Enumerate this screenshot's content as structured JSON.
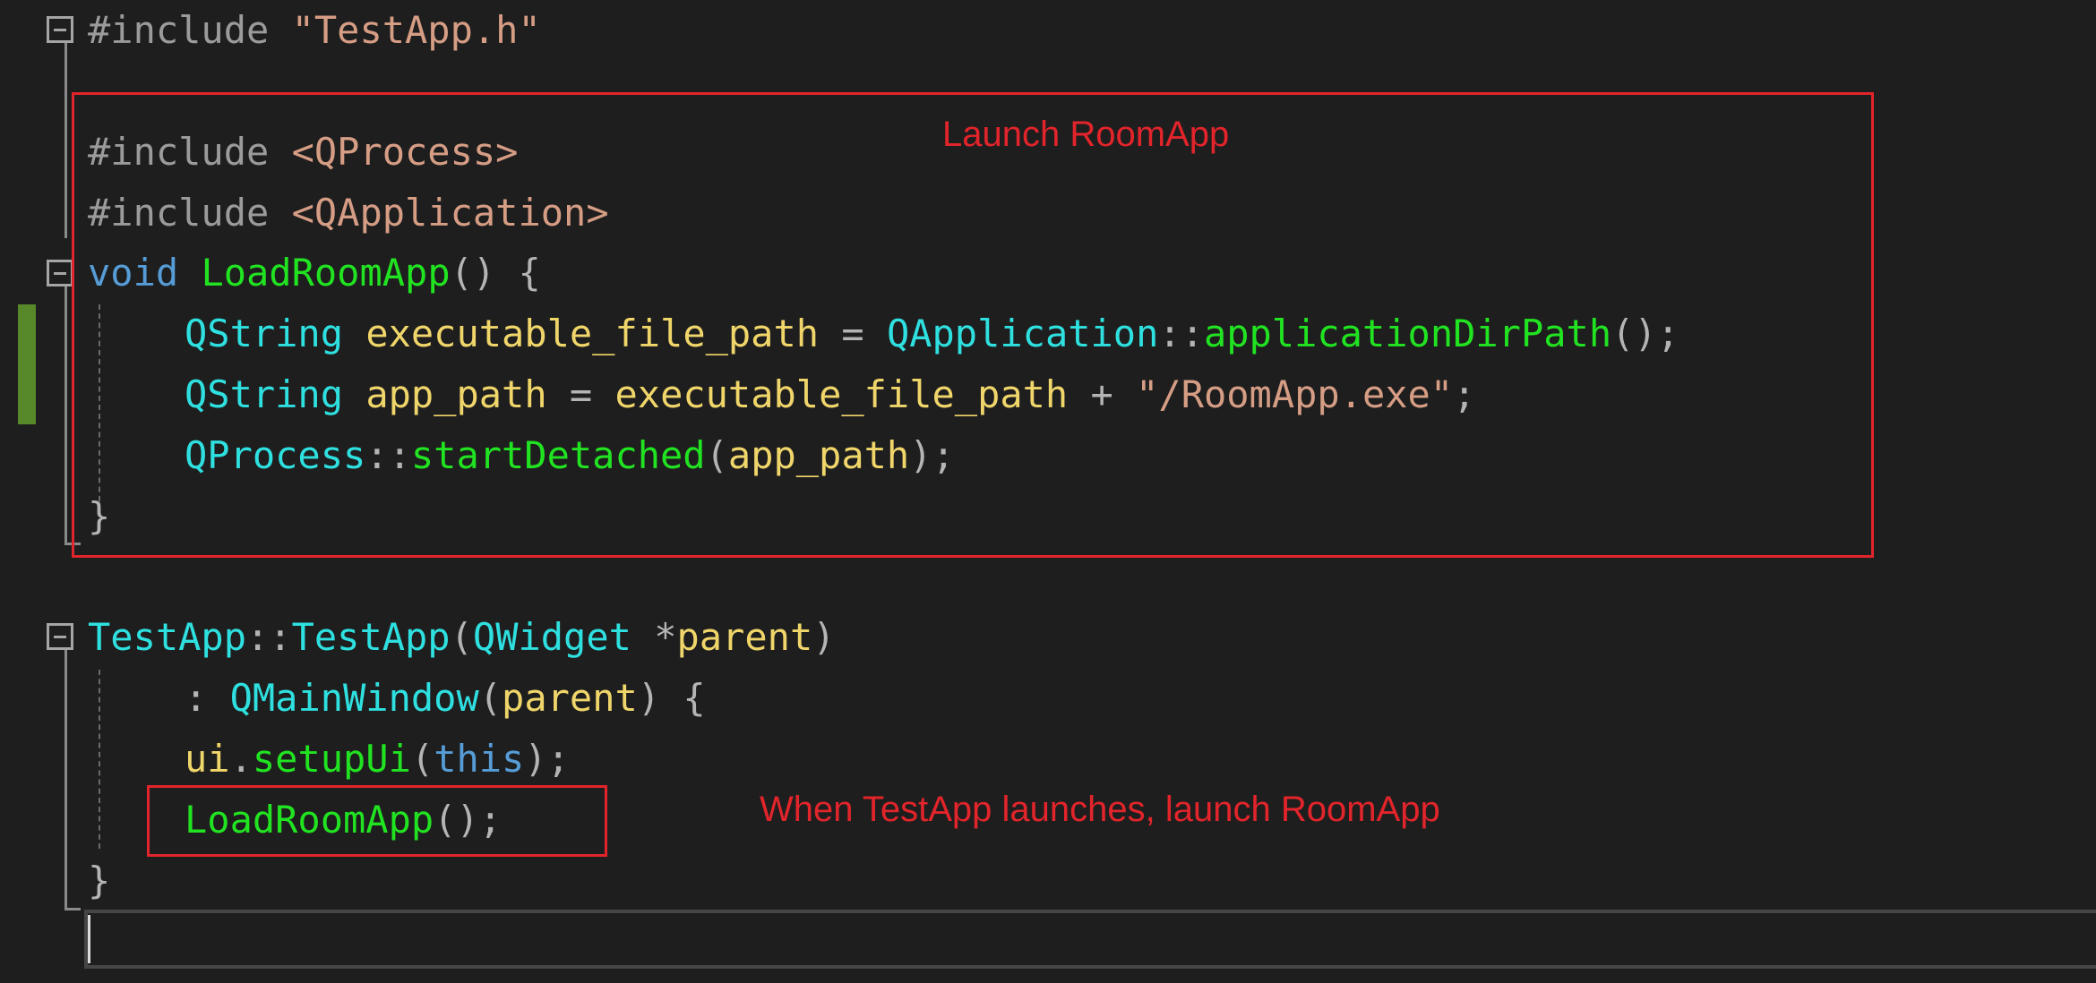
{
  "editor": {
    "lines": [
      {
        "kind": "include",
        "directive": "#include",
        "target": "\"TestApp.h\""
      },
      {
        "kind": "blank"
      },
      {
        "kind": "include",
        "directive": "#include",
        "target": "<QProcess>"
      },
      {
        "kind": "include",
        "directive": "#include",
        "target": "<QApplication>"
      },
      {
        "kind": "code",
        "text": "void LoadRoomApp() {"
      },
      {
        "kind": "code",
        "text": "QString executable_file_path = QApplication::applicationDirPath();"
      },
      {
        "kind": "code",
        "text": "QString app_path = executable_file_path + \"/RoomApp.exe\";"
      },
      {
        "kind": "code",
        "text": "QProcess::startDetached(app_path);"
      },
      {
        "kind": "code",
        "text": "}"
      },
      {
        "kind": "blank"
      },
      {
        "kind": "code",
        "text": "TestApp::TestApp(QWidget *parent)"
      },
      {
        "kind": "code",
        "text": ": QMainWindow(parent) {"
      },
      {
        "kind": "code",
        "text": "ui.setupUi(this);"
      },
      {
        "kind": "code",
        "text": "LoadRoomApp();"
      },
      {
        "kind": "code",
        "text": "}"
      }
    ],
    "tokens": {
      "l1_directive": "#include",
      "l1_target": "\"TestApp.h\"",
      "l3_directive": "#include",
      "l3_target": "<QProcess>",
      "l4_directive": "#include",
      "l4_target": "<QApplication>",
      "l5_void": "void",
      "l5_fn": "LoadRoomApp",
      "l5_rest": "() {",
      "l6_type": "QString",
      "l6_var": "executable_file_path",
      "l6_eq": "=",
      "l6_cls": "QApplication",
      "l6_scope": "::",
      "l6_fn": "applicationDirPath",
      "l6_end": "();",
      "l7_type": "QString",
      "l7_var": "app_path",
      "l7_eq": "=",
      "l7_var2": "executable_file_path",
      "l7_plus": "+",
      "l7_str": "\"/RoomApp.exe\"",
      "l7_end": ";",
      "l8_cls": "QProcess",
      "l8_scope": "::",
      "l8_fn": "startDetached",
      "l8_open": "(",
      "l8_arg": "app_path",
      "l8_end": ");",
      "l9_close": "}",
      "l11_cls": "TestApp",
      "l11_scope": "::",
      "l11_fn": "TestApp",
      "l11_open": "(",
      "l11_type": "QWidget",
      "l11_star": "*",
      "l11_param": "parent",
      "l11_close": ")",
      "l12_colon": ":",
      "l12_cls": "QMainWindow",
      "l12_open": "(",
      "l12_arg": "parent",
      "l12_end": ") {",
      "l13_var": "ui",
      "l13_dot": ".",
      "l13_fn": "setupUi",
      "l13_open": "(",
      "l13_kw": "this",
      "l13_end": ");",
      "l14_fn": "LoadRoomApp",
      "l14_end": "();",
      "l15_close": "}"
    }
  },
  "annotations": {
    "launch_label": "Launch RoomApp",
    "when_label": "When TestApp launches, launch RoomApp",
    "color": "#e2242b"
  },
  "colors": {
    "background": "#1e1e1e",
    "preprocessor": "#9b9b9b",
    "string": "#d69d85",
    "keyword": "#569cd6",
    "function": "#21e321",
    "type": "#2fe0e0",
    "variable": "#f0d66a",
    "punctuation": "#b4b4b4",
    "change_marker": "#57892b"
  },
  "icons": {
    "fold": "collapse-minus-icon"
  }
}
